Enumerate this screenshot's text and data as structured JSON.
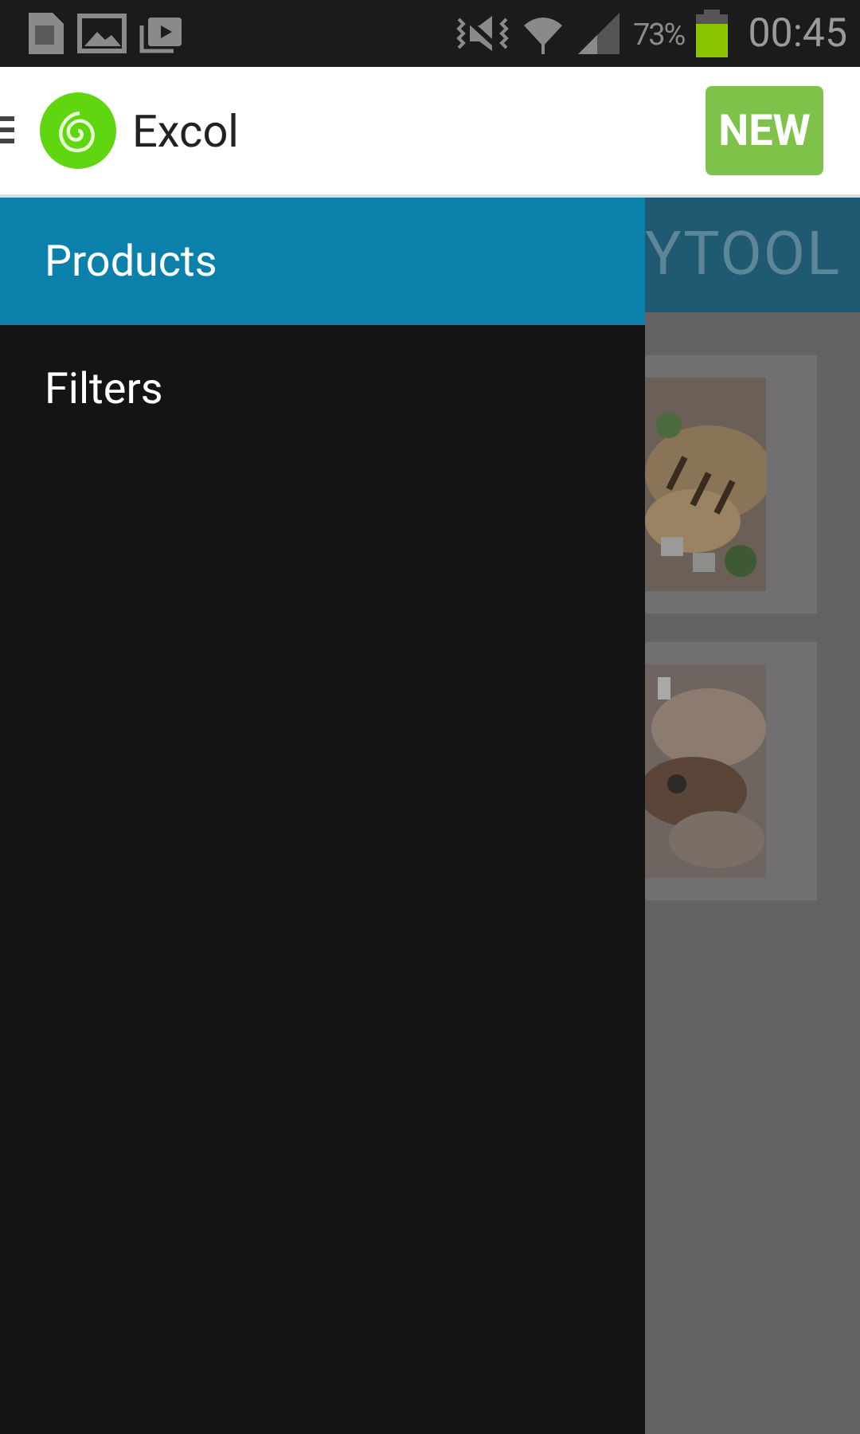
{
  "status_bar": {
    "battery": "73%",
    "time": "00:45"
  },
  "app_bar": {
    "title": "Excol",
    "new_button": "NEW"
  },
  "drawer": {
    "items": [
      {
        "label": "Products",
        "selected": true
      },
      {
        "label": "Filters",
        "selected": false
      }
    ]
  },
  "background": {
    "header_text": "YTOOL"
  }
}
